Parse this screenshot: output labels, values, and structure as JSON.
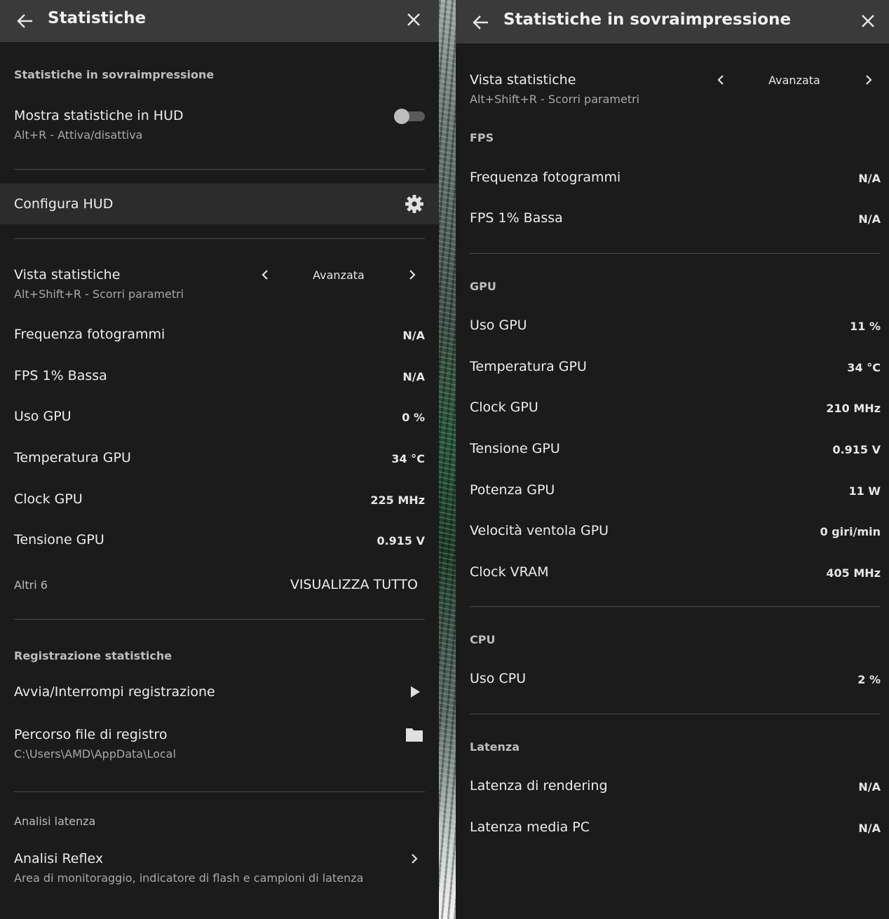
{
  "left": {
    "title": "Statistiche",
    "overlay_section": "Statistiche in sovraimpressione",
    "show_hud": {
      "label": "Mostra statistiche in HUD",
      "shortcut": "Alt+R - Attiva/disattiva",
      "enabled": false
    },
    "configure_hud": "Configura HUD",
    "stats_view": {
      "label": "Vista statistiche",
      "shortcut": "Alt+Shift+R - Scorri parametri",
      "value": "Avanzata"
    },
    "stats": [
      {
        "label": "Frequenza fotogrammi",
        "value": "N/A"
      },
      {
        "label": "FPS 1% Bassa",
        "value": "N/A"
      },
      {
        "label": "Uso GPU",
        "value": "0 %"
      },
      {
        "label": "Temperatura GPU",
        "value": "34 °C"
      },
      {
        "label": "Clock GPU",
        "value": "225 MHz"
      },
      {
        "label": "Tensione GPU",
        "value": "0.915 V"
      }
    ],
    "more_label": "Altri 6",
    "view_all": "VISUALIZZA TUTTO",
    "logging_section": "Registrazione statistiche",
    "start_stop": "Avvia/Interrompi registrazione",
    "log_path": {
      "label": "Percorso file di registro",
      "value": "C:\\Users\\AMD\\AppData\\Local"
    },
    "latency_section": "Analisi latenza",
    "reflex": {
      "label": "Analisi Reflex",
      "description": "Area di monitoraggio, indicatore di flash e campioni di latenza"
    }
  },
  "right": {
    "title": "Statistiche in sovraimpressione",
    "stats_view": {
      "label": "Vista statistiche",
      "shortcut": "Alt+Shift+R - Scorri parametri",
      "value": "Avanzata"
    },
    "groups": [
      {
        "name": "FPS",
        "items": [
          {
            "label": "Frequenza fotogrammi",
            "value": "N/A"
          },
          {
            "label": "FPS 1% Bassa",
            "value": "N/A"
          }
        ]
      },
      {
        "name": "GPU",
        "items": [
          {
            "label": "Uso GPU",
            "value": "11 %"
          },
          {
            "label": "Temperatura GPU",
            "value": "34 °C"
          },
          {
            "label": "Clock GPU",
            "value": "210 MHz"
          },
          {
            "label": "Tensione GPU",
            "value": "0.915 V"
          },
          {
            "label": "Potenza GPU",
            "value": "11 W"
          },
          {
            "label": "Velocità ventola GPU",
            "value": "0 giri/min"
          },
          {
            "label": "Clock VRAM",
            "value": "405 MHz"
          }
        ]
      },
      {
        "name": "CPU",
        "items": [
          {
            "label": "Uso CPU",
            "value": "2 %"
          }
        ]
      },
      {
        "name": "Latenza",
        "items": [
          {
            "label": "Latenza di rendering",
            "value": "N/A"
          },
          {
            "label": "Latenza media PC",
            "value": "N/A"
          }
        ]
      }
    ]
  },
  "icons": [
    "back-arrow-icon",
    "close-icon",
    "gear-icon",
    "chevron-left-icon",
    "chevron-right-icon",
    "play-icon",
    "folder-icon"
  ]
}
